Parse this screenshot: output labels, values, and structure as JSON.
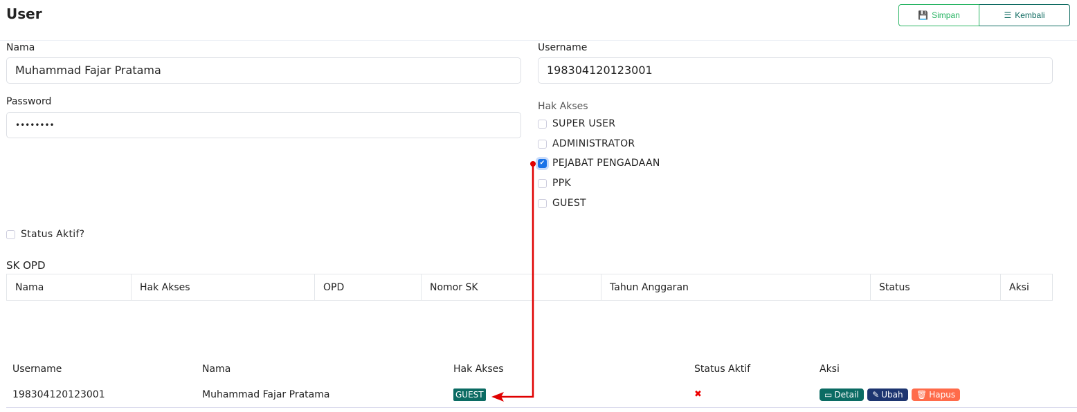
{
  "page": {
    "title": "User"
  },
  "toolbar": {
    "save_label": "Simpan",
    "back_label": "Kembali"
  },
  "form": {
    "nama_label": "Nama",
    "nama_value": "Muhammad Fajar Pratama",
    "username_label": "Username",
    "username_value": "198304120123001",
    "password_label": "Password",
    "password_value": "••••••••",
    "hak_akses_label": "Hak Akses",
    "roles": [
      {
        "label": "SUPER USER",
        "checked": false
      },
      {
        "label": "ADMINISTRATOR",
        "checked": false
      },
      {
        "label": "PEJABAT PENGADAAN",
        "checked": true
      },
      {
        "label": "PPK",
        "checked": false
      },
      {
        "label": "GUEST",
        "checked": false
      }
    ],
    "status_label": "Status Aktif?"
  },
  "sk_opd": {
    "title": "SK OPD",
    "columns": [
      "Nama",
      "Hak Akses",
      "OPD",
      "Nomor SK",
      "Tahun Anggaran",
      "Status",
      "Aksi"
    ]
  },
  "users": {
    "columns": [
      "Username",
      "Nama",
      "Hak Akses",
      "Status Aktif",
      "Aksi"
    ],
    "rows": [
      {
        "username": "198304120123001",
        "nama": "Muhammad Fajar Pratama",
        "hak_akses": "GUEST",
        "status": "✖",
        "detail": "Detail",
        "ubah": "Ubah",
        "hapus": "Hapus"
      }
    ]
  },
  "colors": {
    "primary": "#0b6b63",
    "success": "#28b463",
    "navy": "#1d3570",
    "danger": "#ff6b4a",
    "annotation": "#e00000"
  }
}
